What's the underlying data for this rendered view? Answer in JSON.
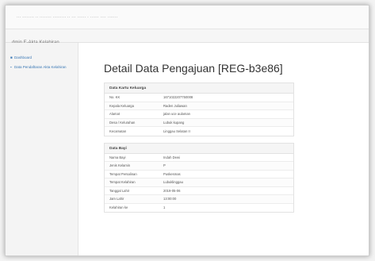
{
  "browser": {
    "url": "··· ········ ·· ········ ········· ·· ··· ······ · ······ ···· ·······"
  },
  "app": {
    "brand": "dmin E-Akta Kelahiran"
  },
  "sidebar": {
    "items": [
      {
        "label": "Dashboard"
      },
      {
        "label": "Data Pendaftaran Akta Kelahiran"
      }
    ]
  },
  "main": {
    "title": "Detail Data Pengajuan [REG-b3e86]",
    "kk_panel": {
      "heading": "Data Kartu Keluarga",
      "rows": [
        {
          "label": "No. KK",
          "value": "1671022207750008"
        },
        {
          "label": "Kepala Keluarga",
          "value": "Raden Juliawan"
        },
        {
          "label": "Alamat",
          "value": "jalan uce aulaman"
        },
        {
          "label": "Desa / Kelurahan",
          "value": "Lubuk kupang"
        },
        {
          "label": "Kecamatan",
          "value": "Linggau Selatan II"
        }
      ]
    },
    "bayi_panel": {
      "heading": "Data Bayi",
      "rows": [
        {
          "label": "Nama Bayi",
          "value": "Indah Dewi"
        },
        {
          "label": "Jenis Kelamin",
          "value": "P"
        },
        {
          "label": "Tempat Persalinan",
          "value": "Puskesmas"
        },
        {
          "label": "Tempat Kelahiran",
          "value": "Lubuklinggau"
        },
        {
          "label": "Tanggal Lahir",
          "value": "2019-05-06"
        },
        {
          "label": "Jam Lahir",
          "value": "13:00:00"
        },
        {
          "label": "Kelahiran ke",
          "value": "1"
        }
      ]
    }
  }
}
